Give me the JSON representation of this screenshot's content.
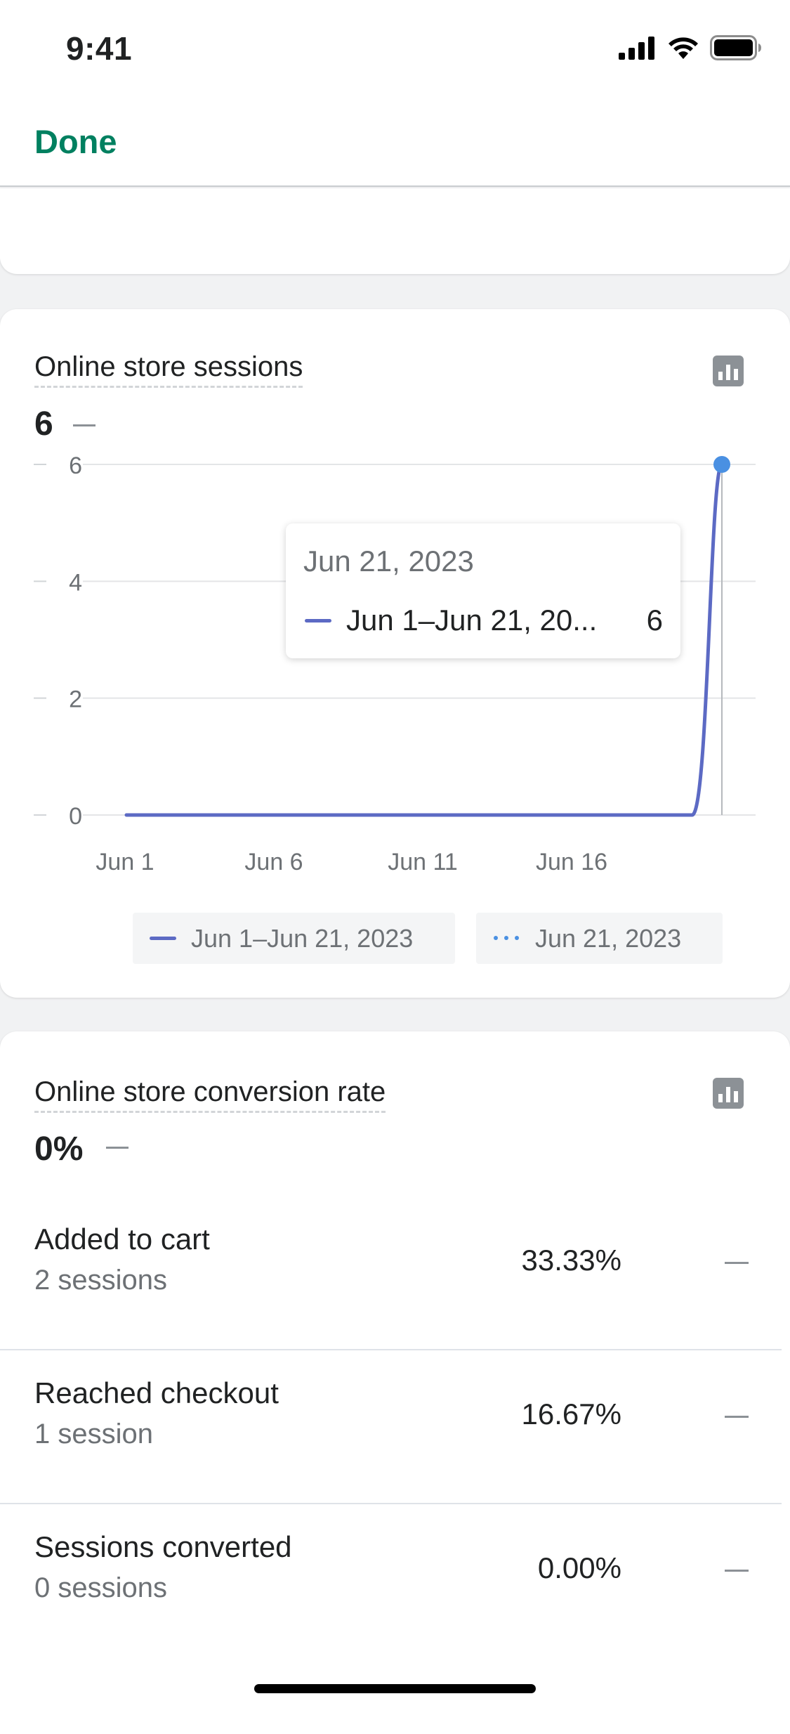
{
  "status_bar": {
    "time": "9:41"
  },
  "nav": {
    "done_label": "Done"
  },
  "sessions_card": {
    "title": "Online store sessions",
    "value": "6"
  },
  "chart_data": {
    "type": "line",
    "x": [
      "Jun 1",
      "Jun 2",
      "Jun 3",
      "Jun 4",
      "Jun 5",
      "Jun 6",
      "Jun 7",
      "Jun 8",
      "Jun 9",
      "Jun 10",
      "Jun 11",
      "Jun 12",
      "Jun 13",
      "Jun 14",
      "Jun 15",
      "Jun 16",
      "Jun 17",
      "Jun 18",
      "Jun 19",
      "Jun 20",
      "Jun 21"
    ],
    "series": [
      {
        "name": "Jun 1–Jun 21, 2023",
        "values": [
          0,
          0,
          0,
          0,
          0,
          0,
          0,
          0,
          0,
          0,
          0,
          0,
          0,
          0,
          0,
          0,
          0,
          0,
          0,
          0,
          6
        ]
      }
    ],
    "xtick_labels": [
      "Jun 1",
      "Jun 6",
      "Jun 11",
      "Jun 16"
    ],
    "ytick_labels": [
      "0",
      "2",
      "4",
      "6"
    ],
    "ylim": [
      0,
      6
    ],
    "grid": true,
    "legend": [
      "Jun 1–Jun 21, 2023",
      "Jun 21, 2023"
    ],
    "legend_position": "bottom",
    "colors": {
      "series": "#5c6ac4",
      "highlight": "#4a90e2"
    },
    "tooltip": {
      "date": "Jun 21, 2023",
      "label": "Jun 1–Jun 21, 20...",
      "value": "6"
    }
  },
  "conversion_card": {
    "title": "Online store conversion rate",
    "value": "0%",
    "rows": [
      {
        "label": "Added to cart",
        "sub": "2 sessions",
        "pct": "33.33%"
      },
      {
        "label": "Reached checkout",
        "sub": "1 session",
        "pct": "16.67%"
      },
      {
        "label": "Sessions converted",
        "sub": "0 sessions",
        "pct": "0.00%"
      }
    ]
  },
  "icons": [
    "signal-icon",
    "wifi-icon",
    "battery-icon",
    "bar-chart-icon"
  ],
  "colors": {
    "accent": "#008060",
    "text": "#202223",
    "subdued": "#6d7175"
  }
}
